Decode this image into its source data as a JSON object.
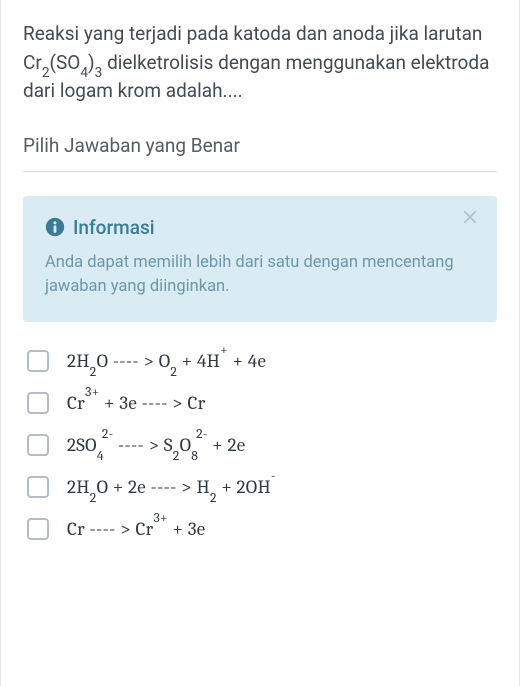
{
  "question": {
    "line1_pre": "Reaksi yang terjadi pada katoda dan anoda jika larutan Cr",
    "sub1": "2",
    "mid1": "(SO",
    "sub2": "4",
    "mid2": ")",
    "sub3": "3",
    "line1_post": " dielketrolisis dengan menggunakan elektroda dari logam krom adalah...."
  },
  "instruction": "Pilih Jawaban yang Benar",
  "info": {
    "title": "Informasi",
    "text": "Anda dapat memilih lebih dari satu dengan mencentang jawaban yang diinginkan."
  },
  "options": {
    "a": {
      "t1": "2H",
      "s1": "2",
      "t2": "O ---- >   O",
      "s2": "2",
      "t3": "  +  4H",
      "p1": "+",
      "t4": "  +  4e"
    },
    "b": {
      "t1": "Cr",
      "p1": "3+",
      "t2": "  +  3e ---- > Cr"
    },
    "c": {
      "t1": "2SO",
      "s1": "4",
      "p1": "2-",
      "t2": "  ---- > S",
      "s2": "2",
      "t3": "O",
      "s3": "8",
      "p2": "2-",
      "t4": "  +  2e"
    },
    "d": {
      "t1": "2H",
      "s1": "2",
      "t2": "O  +  2e   ---- >  H",
      "s2": "2",
      "t3": "  +  2OH",
      "p1": "-"
    },
    "e": {
      "t1": "Cr  ---- > Cr",
      "p1": "3+",
      "t2": "  +  3e"
    }
  }
}
